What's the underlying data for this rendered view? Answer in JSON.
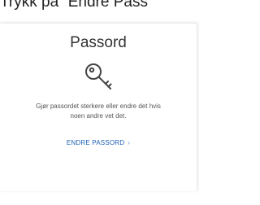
{
  "caption": "Trykk på “Endre Pass",
  "card": {
    "title": "Passord",
    "icon": "key-icon",
    "description_line1": "Gjør passordet sterkere eller endre det hvis",
    "description_line2": "noen andre vet det.",
    "action_label": "ENDRE PASSORD",
    "action_chevron": "›"
  },
  "colors": {
    "link": "#1a5fb4",
    "title": "#333333",
    "text": "#555555"
  }
}
